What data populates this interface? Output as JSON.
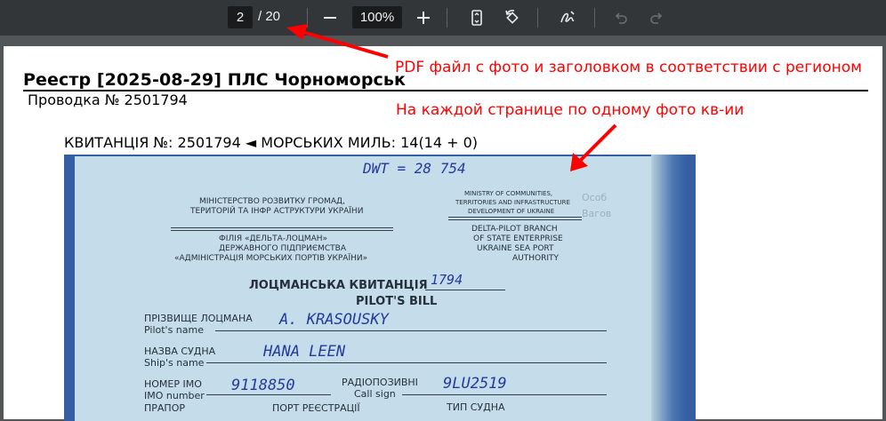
{
  "toolbar": {
    "current_page": "2",
    "total_pages": "/ 20",
    "zoom": "100%",
    "buttons": {
      "zoom_out_icon": "minus-icon",
      "zoom_in_icon": "plus-icon",
      "fit_page_icon": "fit-page-icon",
      "rotate_icon": "rotate-icon",
      "annotate_icon": "pen-icon",
      "undo_icon": "undo-icon",
      "redo_icon": "redo-icon"
    }
  },
  "document": {
    "title": "Реестр [2025-08-29] ПЛС Чорноморськ",
    "subtitle": "Проводка № 2501794",
    "receipt_caption": "КВИТАНЦІЯ №: 2501794  ◄  МОРСЬКИХ МИЛЬ: 14(14 + 0)"
  },
  "receipt_photo": {
    "handwritten_dwt": "DWT = 28 754",
    "ministry_ua_line1": "МІНІСТЕРСТВО РОЗВИТКУ ГРОМАД,",
    "ministry_ua_line2": "ТЕРИТОРІЙ ТА ІНФР  АСТРУКТУРИ УКРАЇНИ",
    "ministry_en_line1": "MINISTRY OF COMMUNITIES,",
    "ministry_en_line2": "TERRITORIES AND   INFRASTRUCTURE",
    "ministry_en_line3": "DEVELOPMENT   OF UKRAINE",
    "branch_ua_line1": "ФІЛІЯ «ДЕЛЬТА-ЛОЦМАН»",
    "branch_ua_line2": "ДЕРЖАВНОГО ПІДПРИЄМСТВА",
    "branch_ua_line3": "«АДМІНІСТРАЦІЯ МОРСЬКИХ ПОРТІВ УКРАЇНИ»",
    "branch_en_line1": "DELTA-PILOT BRANCH",
    "branch_en_line2": "OF STATE ENTERPRISE",
    "branch_en_line3": "UKRAINE SEA PORT",
    "branch_en_line4": "AUTHORITY",
    "bill_title_ua": "ЛОЦМАНСЬКА КВИТАНЦІЯ",
    "bill_number": "1794",
    "bill_title_en": "PILOT'S BILL",
    "pilot_label_ua": "ПРІЗВИЩЕ ЛОЦМАНА",
    "pilot_label_en": "Pilot's name",
    "pilot_value": "A. KRASOUSKY",
    "ship_label_ua": "НАЗВА СУДНА",
    "ship_label_en": "Ship's name",
    "ship_value": "HANA   LEEN",
    "imo_label_ua": "НОМЕР ІМО",
    "imo_label_en": "IMO number",
    "imo_value": "9118850",
    "callsign_label_ua": "РАДІОПОЗИВНІ",
    "callsign_label_en": "Call sign",
    "callsign_value": "9LU2519",
    "flag_label_ua": "ПРАПОР",
    "port_label_ua": "ПОРТ РЕЄСТРАЦІЇ",
    "type_label_ua": "ТИП СУДНА",
    "faded_stamp_line1": "Особ",
    "faded_stamp_line2": "Вагов"
  },
  "annotations": {
    "note_1": "PDF файл с фото и заголовком в соответствии с регионом",
    "note_2": "На каждой странице по одному фото кв-ии",
    "color": "#ff0000"
  }
}
